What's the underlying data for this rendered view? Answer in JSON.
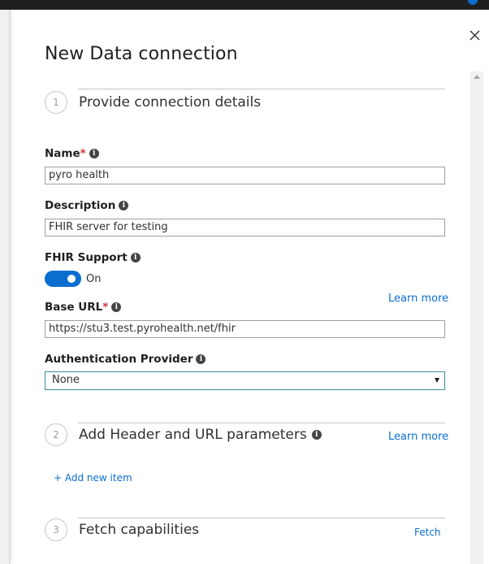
{
  "panel": {
    "title": "New Data connection",
    "close_icon": "close-icon"
  },
  "steps": [
    {
      "number": "1",
      "title": "Provide connection details"
    },
    {
      "number": "2",
      "title": "Add Header and URL parameters"
    },
    {
      "number": "3",
      "title": "Fetch capabilities"
    }
  ],
  "fields": {
    "name": {
      "label": "Name",
      "required_mark": "*",
      "value": "pyro health"
    },
    "description": {
      "label": "Description",
      "value": "FHIR server for testing"
    },
    "fhir_support": {
      "label": "FHIR Support",
      "state": "On",
      "enabled": true
    },
    "base_url": {
      "label": "Base URL",
      "required_mark": "*",
      "value": "https://stu3.test.pyrohealth.net/fhir"
    },
    "auth_provider": {
      "label": "Authentication Provider",
      "selected": "None"
    }
  },
  "links": {
    "learn_more_url": "Learn more",
    "learn_more_params": "Learn more",
    "add_new_item": "+ Add new item",
    "fetch": "Fetch"
  },
  "info_glyph": "i",
  "colors": {
    "accent": "#0a6ed1",
    "required": "#d13438",
    "topbar": "#1f1f1f"
  }
}
